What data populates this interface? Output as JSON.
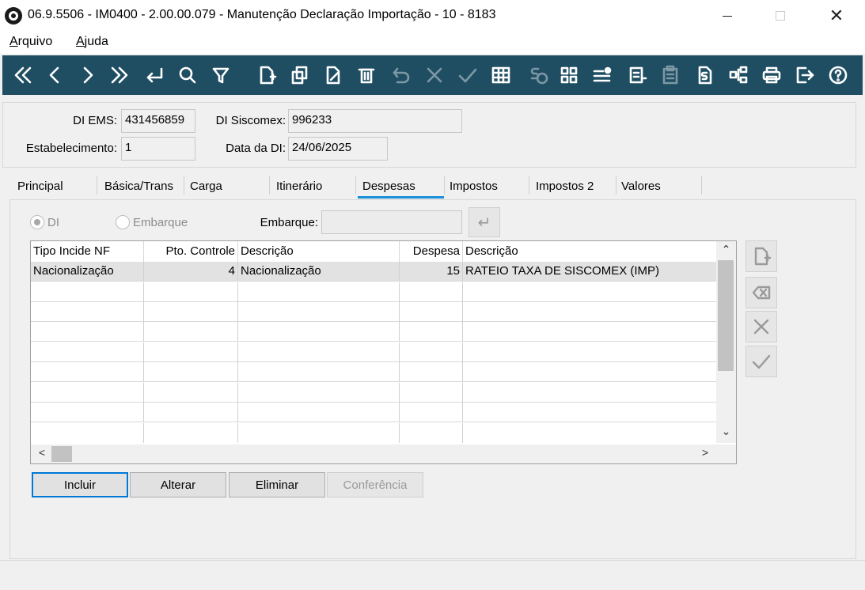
{
  "window": {
    "title": "06.9.5506 - IM0400 - 2.00.00.079 - Manutenção Declaração Importação - 10 - 8183",
    "close_glyph": "✕"
  },
  "menu": {
    "items": [
      {
        "label": "Arquivo",
        "accel": "A",
        "rest": "rquivo"
      },
      {
        "label": "Ajuda",
        "accel": "A",
        "rest": "juda"
      }
    ]
  },
  "toolbar": {
    "icons": [
      "first-icon",
      "previous-icon",
      "next-icon",
      "last-icon",
      "goto-icon",
      "search-icon",
      "filter-icon",
      "new-icon",
      "copy-icon",
      "edit-icon",
      "delete-icon",
      "undo-icon",
      "cancel-icon",
      "confirm-icon",
      "grid-icon",
      "currency-icon",
      "apps-icon",
      "list-alert-icon",
      "report-icon",
      "clipboard-icon",
      "document-money-icon",
      "tree-icon",
      "print-icon",
      "exit-icon",
      "help-icon"
    ]
  },
  "header": {
    "di_ems_label": "DI EMS:",
    "di_ems_value": "431456859",
    "di_siscomex_label": "DI Siscomex:",
    "di_siscomex_value": "996233",
    "estabelecimento_label": "Estabelecimento:",
    "estabelecimento_value": "1",
    "data_di_label": "Data da DI:",
    "data_di_value": "24/06/2025"
  },
  "tabs": [
    {
      "label": "Principal"
    },
    {
      "label": "Básica/Trans"
    },
    {
      "label": "Carga"
    },
    {
      "label": "Itinerário"
    },
    {
      "label": "Despesas",
      "active": true
    },
    {
      "label": "Impostos"
    },
    {
      "label": "Impostos 2"
    },
    {
      "label": "Valores"
    }
  ],
  "despesas": {
    "radio_di": "DI",
    "radio_embarque": "Embarque",
    "embarque_label": "Embarque:",
    "embarque_value": "",
    "goto_glyph": "↵",
    "columns": [
      "Tipo Incide NF",
      "Pto. Controle",
      "Descrição",
      "Despesa",
      "Descrição"
    ],
    "rows": [
      [
        "Nacionalização",
        "4",
        "Nacionalização",
        "15",
        "RATEIO TAXA DE SISCOMEX (IMP)"
      ]
    ],
    "scroll_up": "⌃",
    "scroll_down": "⌄",
    "scroll_left": "<",
    "scroll_right": ">",
    "buttons": {
      "incluir": "Incluir",
      "alterar": "Alterar",
      "eliminar": "Eliminar",
      "conferencia": "Conferência"
    }
  },
  "colors": {
    "toolbar_bg": "#1f4e63",
    "active_tab": "#1a8fd8",
    "default_button_border": "#0078d7"
  }
}
